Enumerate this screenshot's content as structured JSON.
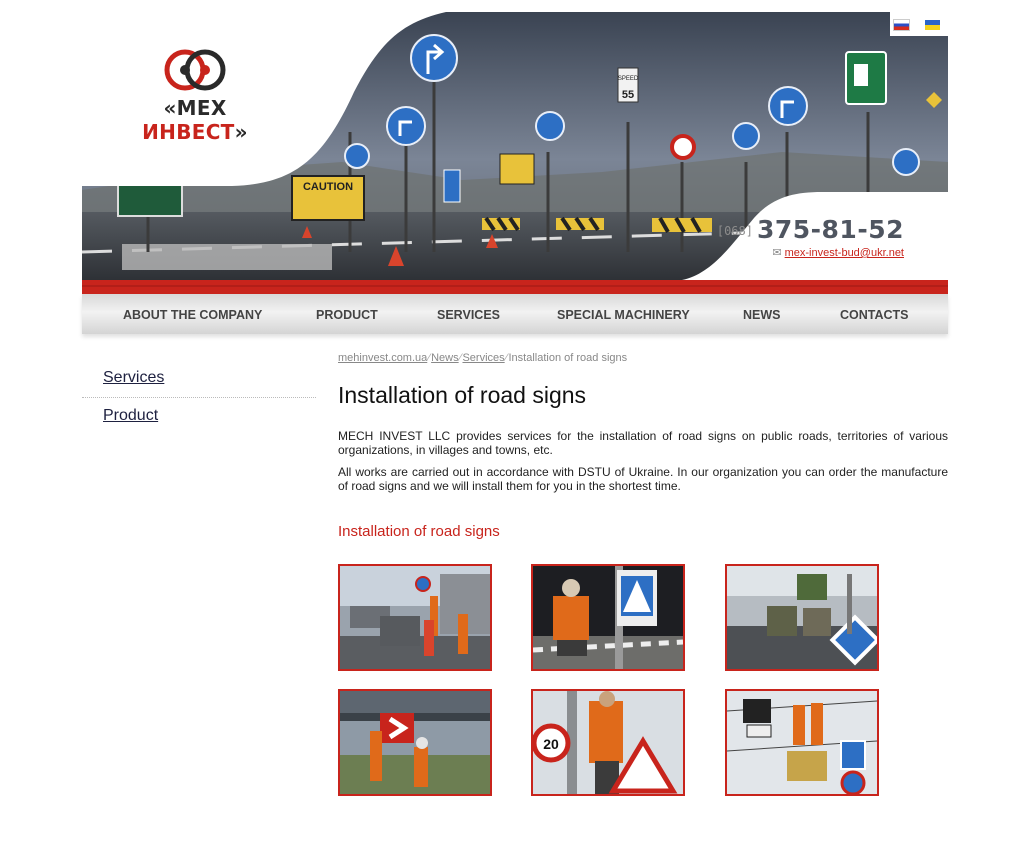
{
  "brand": {
    "logo_prefix": "«МЕХ ",
    "logo_accent": "ИНВЕСТ",
    "logo_suffix": "»"
  },
  "contacts": {
    "phone_code": "[068]",
    "phone_number": "375-81-52",
    "email": "mex-invest-bud@ukr.net"
  },
  "languages": [
    "ru",
    "ua"
  ],
  "nav": {
    "items": [
      "ABOUT THE COMPANY",
      "PRODUCT",
      "SERVICES",
      "SPECIAL MACHINERY",
      "NEWS",
      "CONTACTS"
    ]
  },
  "sidebar": {
    "items": [
      "Services",
      "Product"
    ]
  },
  "breadcrumb": {
    "home": "mehinvest.com.ua",
    "news": "News",
    "services": "Services",
    "current": "Installation of road signs",
    "separator": "⁄"
  },
  "content": {
    "title": "Installation of road signs",
    "paragraph1": "MECH INVEST LLC provides services for the installation of road signs on public roads, territories of various organizations, in villages and towns, etc.",
    "paragraph2": "All works are carried out in accordance with DSTU of Ukraine. In our organization you can order the manufacture of road signs and we will install them for you in the shortest time.",
    "gallery_title": "Installation of road signs"
  },
  "colors": {
    "accent": "#c8241c",
    "nav_text": "#444444",
    "link": "#1e2140"
  }
}
